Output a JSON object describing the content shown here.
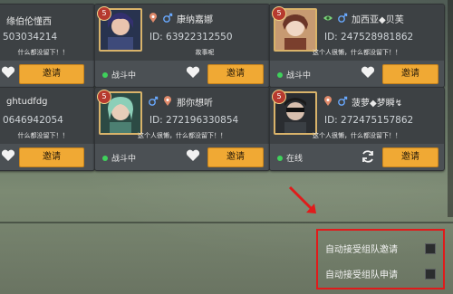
{
  "cards": [
    {
      "id": "card-1",
      "name": "缘伯伦懂西",
      "id_text": "503034214",
      "signature": "什么都没留下！！",
      "status": "",
      "invite": "邀请"
    },
    {
      "id": "card-2",
      "level": "5",
      "name": "康纳嘉娜",
      "id_text": "ID: 63922312550",
      "signature": "故事呢",
      "status": "战斗中",
      "invite": "邀请"
    },
    {
      "id": "card-3",
      "level": "5",
      "name": "加西亚◆贝芙",
      "id_text": "ID: 247528981862",
      "signature": "这个人很懒，什么都没留下！！",
      "status": "战斗中",
      "invite": "邀请"
    },
    {
      "id": "card-4",
      "name": "ghtudfdg",
      "id_text": "0646942054",
      "signature": "什么都没留下！！",
      "status": "",
      "invite": "邀请"
    },
    {
      "id": "card-5",
      "level": "5",
      "name": "那你想听",
      "id_text": "ID: 272196330854",
      "signature": "这个人很懒，什么都没留下！！",
      "status": "战斗中",
      "invite": "邀请"
    },
    {
      "id": "card-6",
      "level": "5",
      "name": "菠萝◆梦瞬↯",
      "id_text": "ID: 272475157862",
      "signature": "这个人很懒，什么都没留下！！",
      "status": "在线",
      "invite": "邀请"
    }
  ],
  "settings": {
    "auto_accept_team_invite": "自动接受组队邀请",
    "auto_accept_team_apply": "自动接受组队申请"
  },
  "colors": {
    "accent": "#f0a934",
    "online": "#3fd15b",
    "highlight": "#e01b1b"
  }
}
